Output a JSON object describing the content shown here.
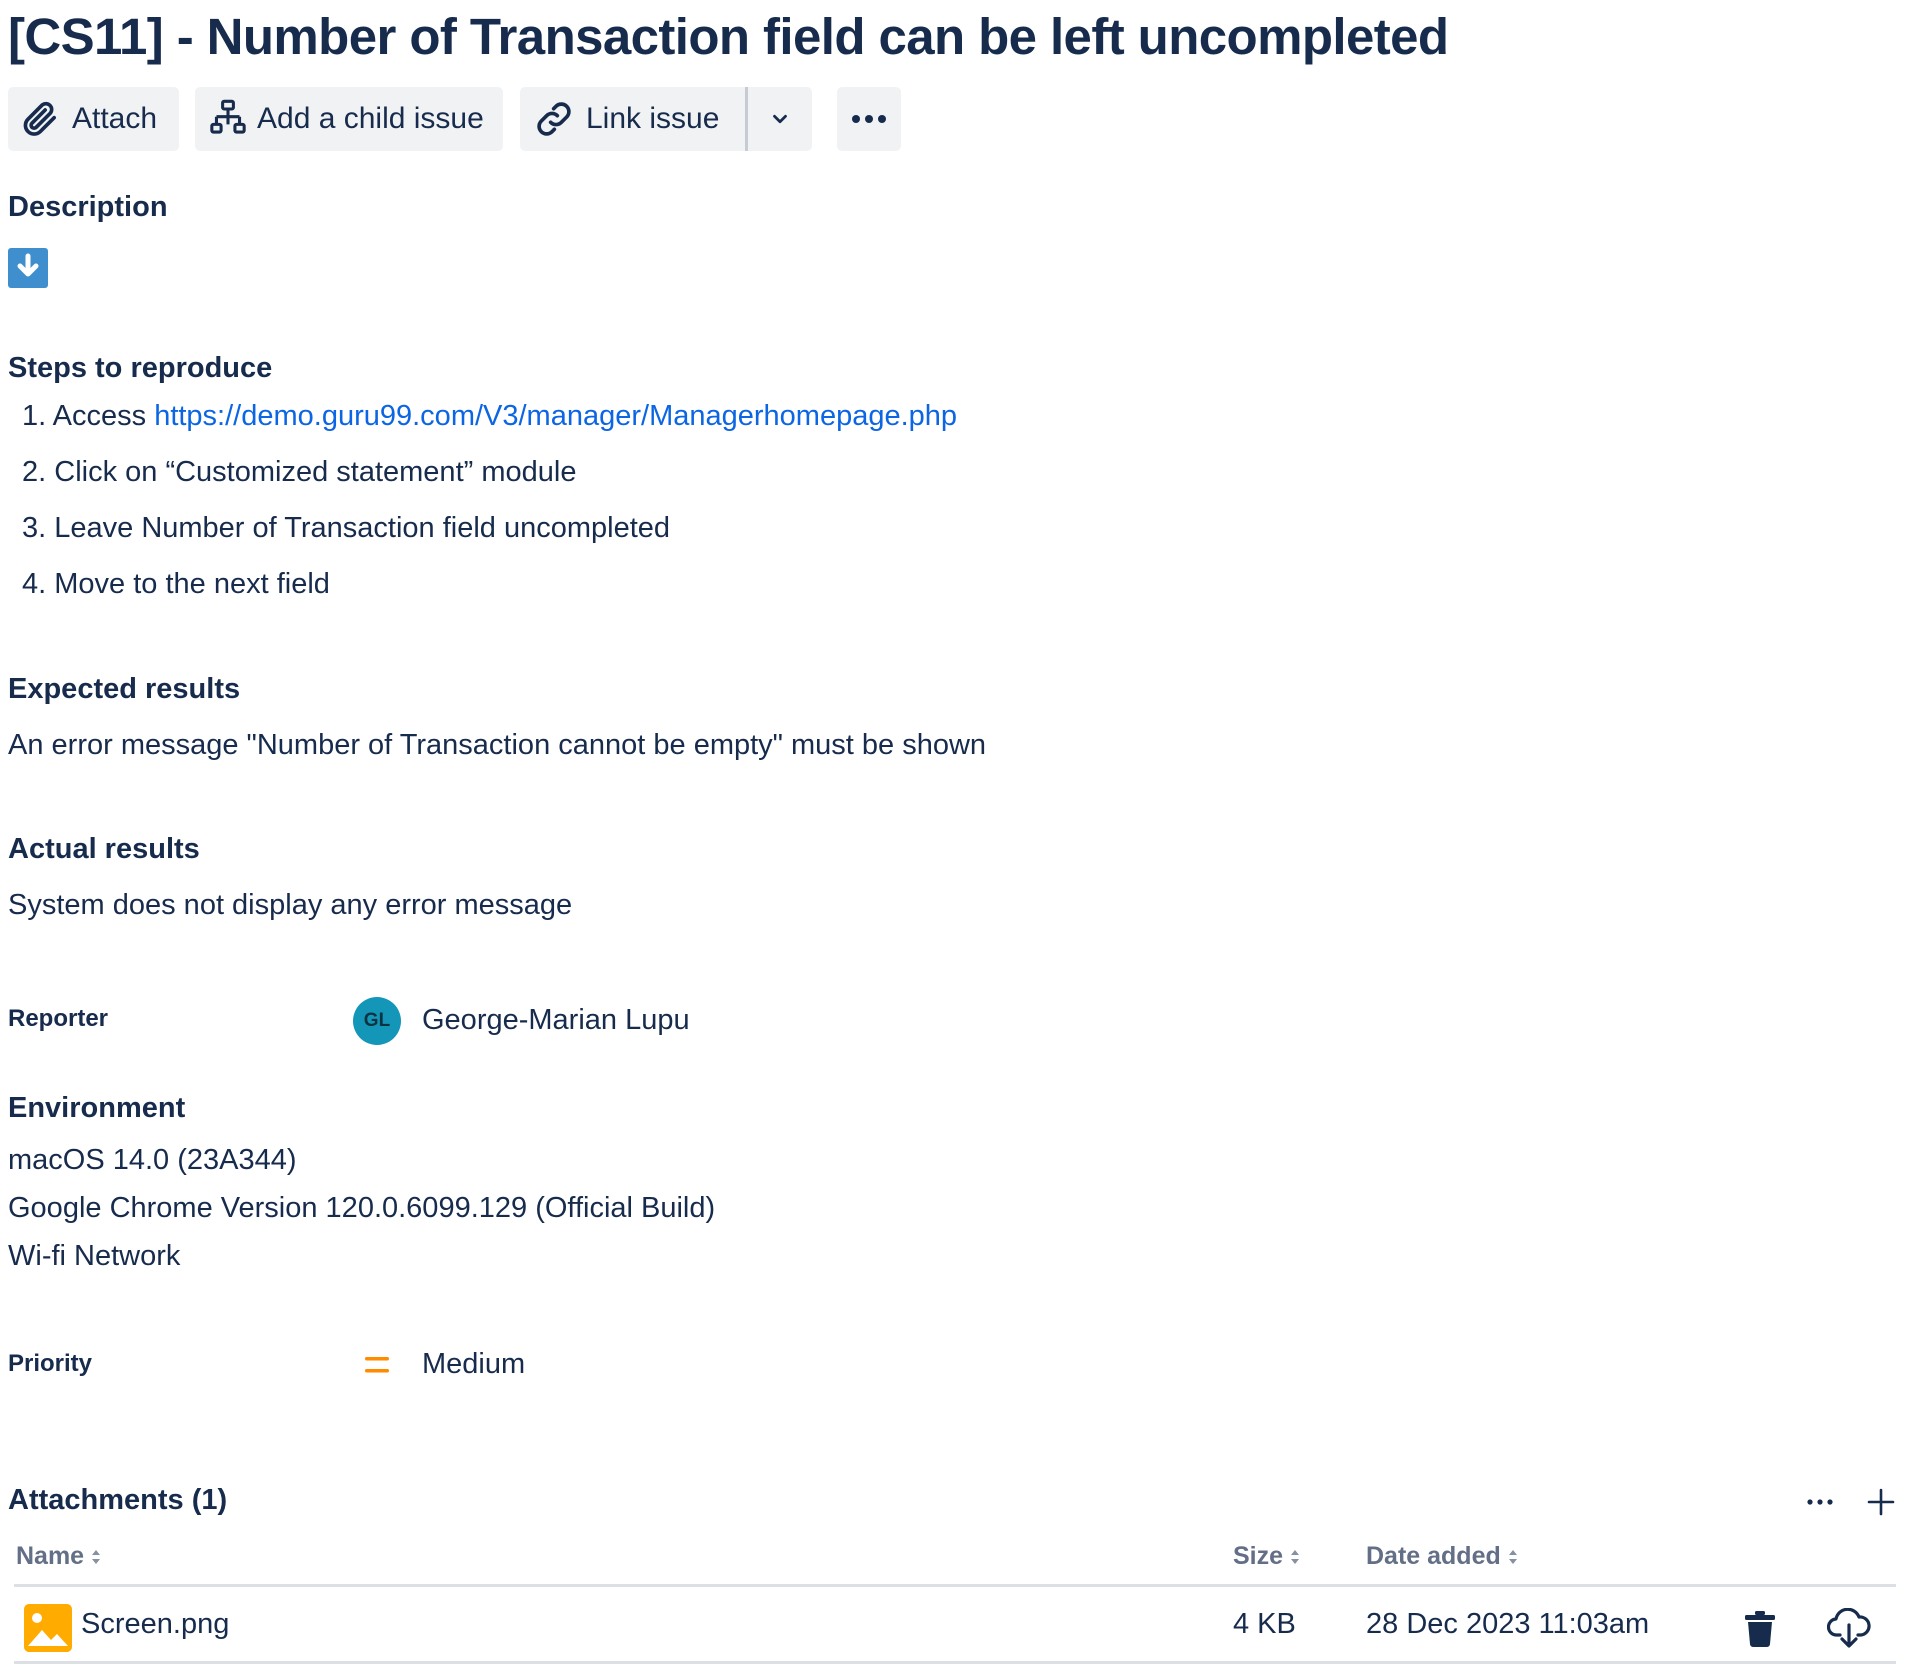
{
  "issue": {
    "title": "[CS11] - Number of Transaction field can be left uncompleted"
  },
  "toolbar": {
    "attach_label": "Attach",
    "add_child_label": "Add a child issue",
    "link_issue_label": "Link issue"
  },
  "description": {
    "heading": "Description"
  },
  "steps": {
    "heading": "Steps to reproduce",
    "items": [
      {
        "number": "1.",
        "prefix": "Access ",
        "link": "https://demo.guru99.com/V3/manager/Managerhomepage.php"
      },
      {
        "number": "2.",
        "text": "Click on “Customized statement” module"
      },
      {
        "number": "3.",
        "text": "Leave Number of Transaction field uncompleted"
      },
      {
        "number": "4.",
        "text": "Move to the next field"
      }
    ]
  },
  "expected": {
    "heading": "Expected results",
    "text": "An error message \"Number of Transaction cannot be empty\" must be shown"
  },
  "actual": {
    "heading": "Actual results",
    "text": "System does not display any error message"
  },
  "reporter": {
    "label": "Reporter",
    "initials": "GL",
    "name": "George-Marian Lupu"
  },
  "environment": {
    "heading": "Environment",
    "lines": [
      "macOS 14.0 (23A344)",
      "Google Chrome Version 120.0.6099.129 (Official Build)",
      "Wi-fi Network"
    ]
  },
  "priority": {
    "label": "Priority",
    "value": "Medium",
    "icon": "priority-medium-icon"
  },
  "attachments": {
    "heading": "Attachments (1)",
    "columns": [
      "Name",
      "Size",
      "Date added"
    ],
    "rows": [
      {
        "name": "Screen.png",
        "size": "4 KB",
        "date_added": "28 Dec 2023 11:03am"
      }
    ]
  },
  "colors": {
    "text": "#172b4d",
    "link": "#0c66e4",
    "button_bg": "#f1f2f4",
    "avatar_bg": "#1496b8",
    "priority_medium": "#ff8b00",
    "image_icon": "#ffab00",
    "muted": "#626f86"
  }
}
